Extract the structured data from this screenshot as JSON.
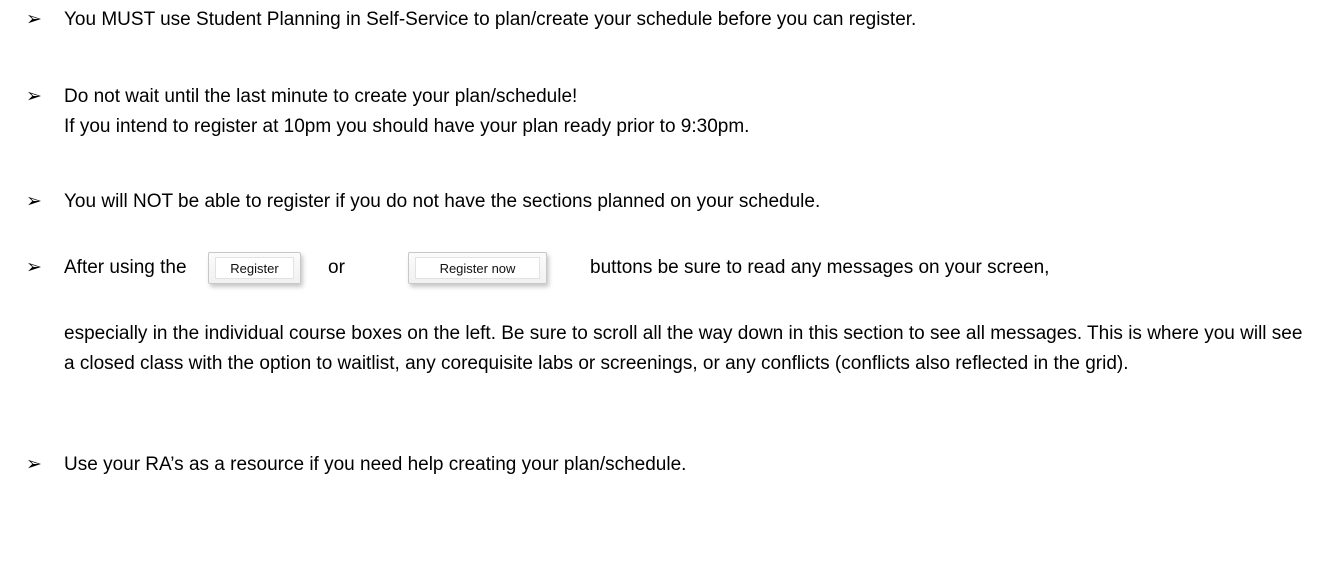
{
  "bullet_glyph": "➢",
  "items": {
    "b1": "You MUST use Student Planning in Self-Service to plan/create your schedule before you can register.",
    "b2_line1": "Do not wait until the last minute to create your plan/schedule!",
    "b2_line2": "If you intend to register at 10pm you should have your plan ready prior to 9:30pm.",
    "b3": "You will NOT be able to register if you do not have the sections planned on your schedule.",
    "b4_prefix": "After using the",
    "b4_or": "or",
    "b4_suffix": "buttons be sure to read any messages on your screen,",
    "b4_paragraph": "especially in the individual  course boxes on the left. Be sure to scroll all the way down in this section to see all messages. This is where you will see a closed class with the option to waitlist, any corequisite labs or screenings, or any conflicts (conflicts also reflected in the grid).",
    "b5": "Use your RA’s as a resource if you need help creating your plan/schedule."
  },
  "buttons": {
    "register_label": "Register",
    "register_now_label": "Register now"
  }
}
